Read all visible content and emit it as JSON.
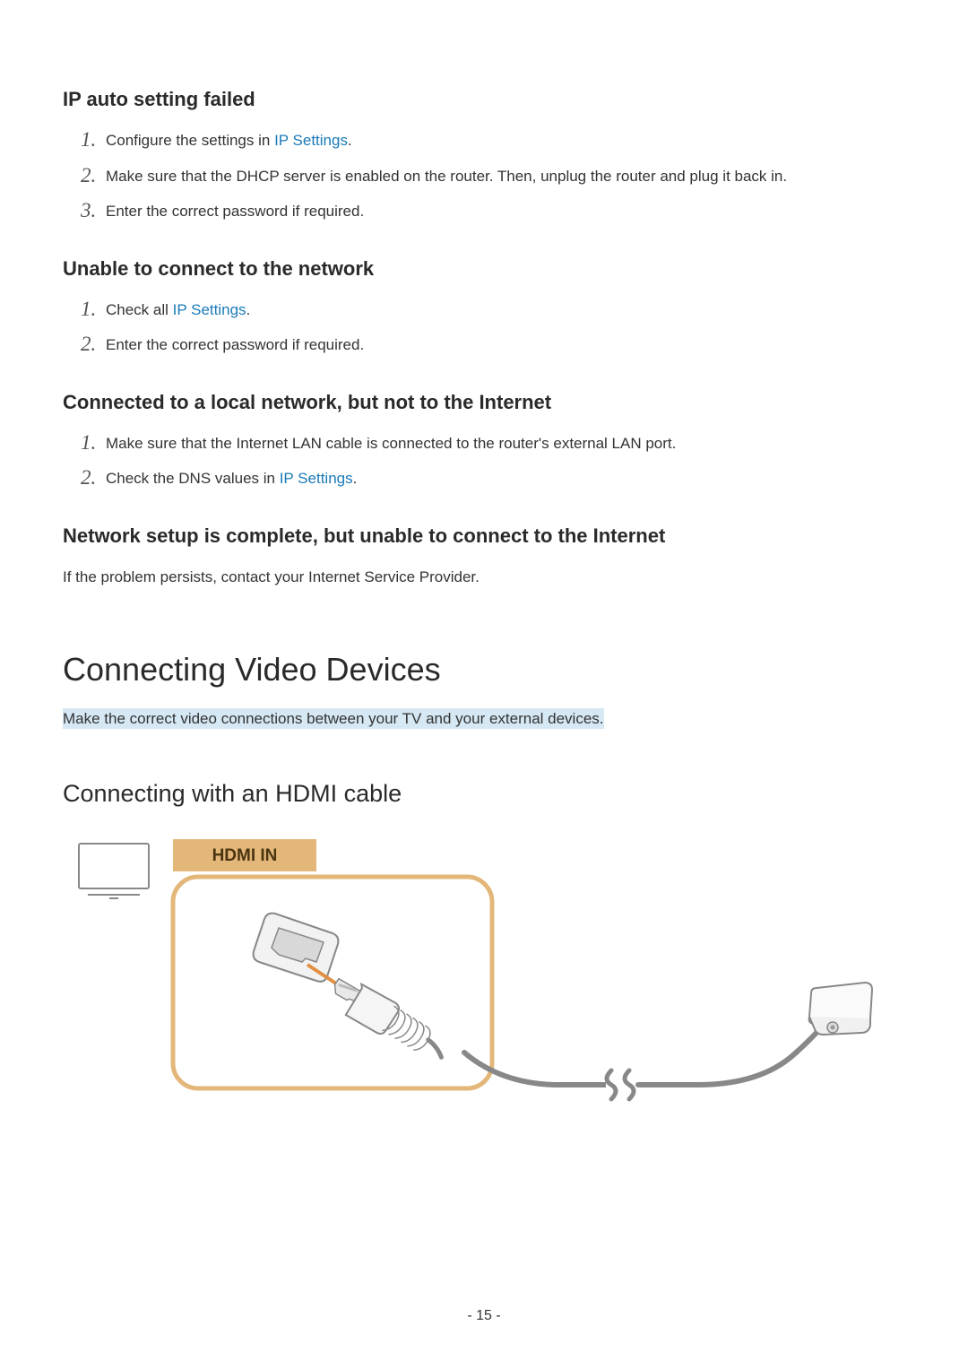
{
  "sections": {
    "s1": {
      "title": "IP auto setting failed",
      "items": [
        {
          "pre": "Configure the settings in ",
          "link": "IP Settings",
          "post": "."
        },
        {
          "pre": "Make sure that the DHCP server is enabled on the router. Then, unplug the router and plug it back in.",
          "link": "",
          "post": ""
        },
        {
          "pre": "Enter the correct password if required.",
          "link": "",
          "post": ""
        }
      ]
    },
    "s2": {
      "title": "Unable to connect to the network",
      "items": [
        {
          "pre": "Check all ",
          "link": "IP Settings",
          "post": "."
        },
        {
          "pre": "Enter the correct password if required.",
          "link": "",
          "post": ""
        }
      ]
    },
    "s3": {
      "title": "Connected to a local network, but not to the Internet",
      "items": [
        {
          "pre": "Make sure that the Internet LAN cable is connected to the router's external LAN port.",
          "link": "",
          "post": ""
        },
        {
          "pre": "Check the DNS values in ",
          "link": "IP Settings",
          "post": "."
        }
      ]
    },
    "s4": {
      "title": "Network setup is complete, but unable to connect to the Internet",
      "body": "If the problem persists, contact your Internet Service Provider."
    }
  },
  "main": {
    "title": "Connecting Video Devices",
    "highlight": "Make the correct video connections between your TV and your external devices."
  },
  "sub": {
    "title": "Connecting with an HDMI cable",
    "label": "HDMI IN"
  },
  "page": "- 15 -"
}
